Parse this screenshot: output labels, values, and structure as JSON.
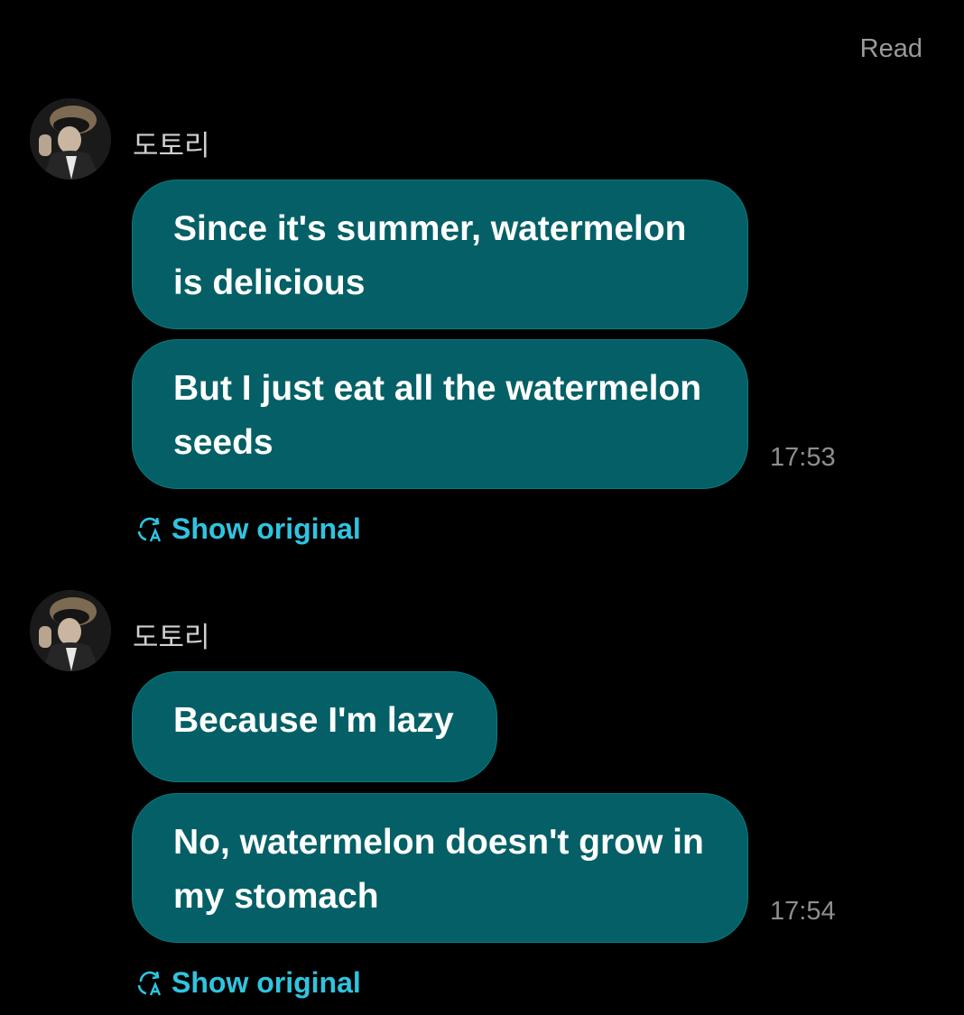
{
  "read_status": "Read",
  "groups": [
    {
      "sender": "도토리",
      "messages": [
        {
          "text": "Since it's summer, watermelon is delicious"
        },
        {
          "text": "But I just eat all the watermelon seeds"
        }
      ],
      "time": "17:53",
      "show_original_label": "Show original"
    },
    {
      "sender": "도토리",
      "messages": [
        {
          "text": "Because I'm lazy"
        },
        {
          "text": "No, watermelon doesn't grow in my stomach"
        }
      ],
      "time": "17:54",
      "show_original_label": "Show original"
    }
  ],
  "icons": {
    "translate": "translate-icon",
    "avatar": "user-avatar"
  },
  "colors": {
    "background": "#000000",
    "bubble": "#046066",
    "link": "#2fc4e0",
    "muted": "#8e8e8e"
  }
}
